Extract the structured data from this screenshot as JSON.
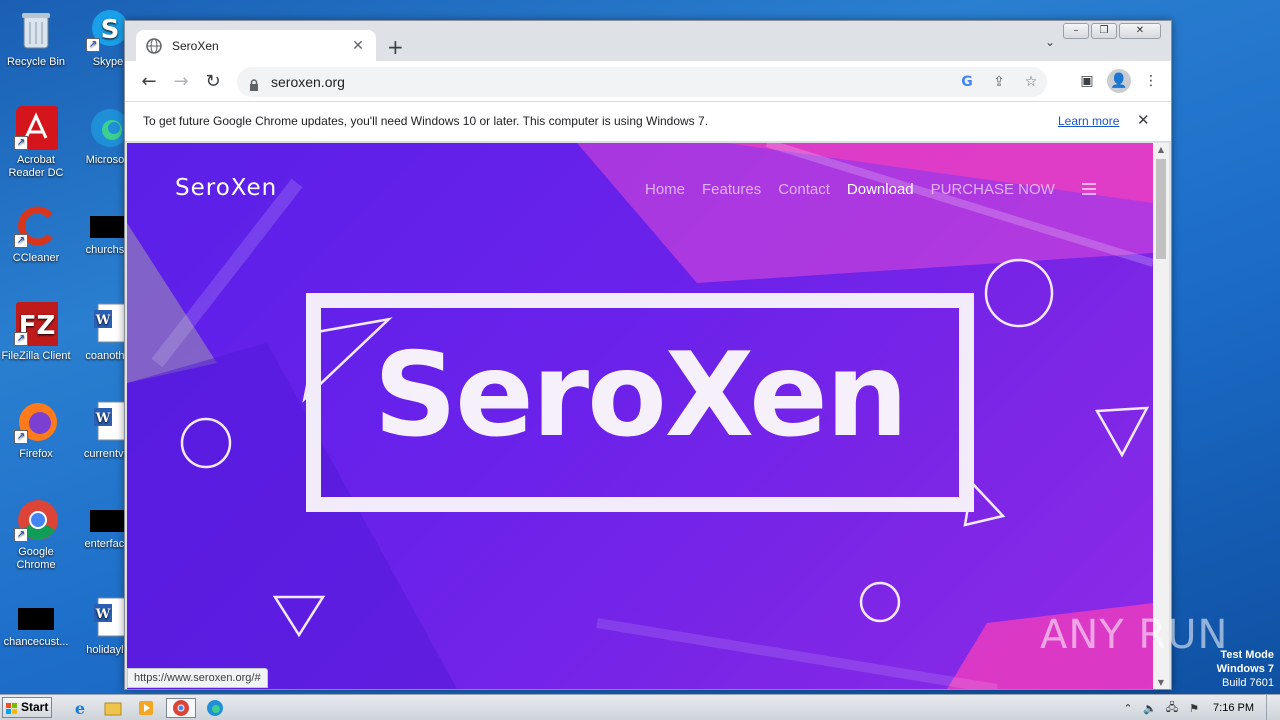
{
  "desktop": {
    "icons": [
      {
        "label": "Recycle Bin"
      },
      {
        "label": "Skype"
      },
      {
        "label": "Acrobat Reader DC"
      },
      {
        "label": "Microsoft"
      },
      {
        "label": "CCleaner"
      },
      {
        "label": "churchso"
      },
      {
        "label": "FileZilla Client"
      },
      {
        "label": "coanothe"
      },
      {
        "label": "Firefox"
      },
      {
        "label": "currentvie"
      },
      {
        "label": "Google Chrome"
      },
      {
        "label": "enterfacili"
      },
      {
        "label": "chancecust..."
      },
      {
        "label": "holidaylo"
      }
    ]
  },
  "browser": {
    "tab_title": "SeroXen",
    "url": "seroxen.org",
    "infobar": {
      "message": "To get future Google Chrome updates, you'll need Windows 10 or later. This computer is using Windows 7.",
      "link": "Learn more"
    },
    "status_url": "https://www.seroxen.org/#"
  },
  "site": {
    "brand": "SeroXen",
    "nav": [
      "Home",
      "Features",
      "Contact",
      "Download",
      "PURCHASE NOW"
    ],
    "hero_title": "SeroXen"
  },
  "watermark": {
    "text": "ANY RUN",
    "testmode_line1": "Test Mode",
    "testmode_line2": "Windows 7",
    "testmode_line3": "Build 7601"
  },
  "taskbar": {
    "start_label": "Start",
    "clock": "7:16 PM"
  },
  "colors": {
    "hero_purple": "#6b22ea",
    "accent_pink": "#ff3fb8",
    "link_blue": "#1a56c8"
  }
}
